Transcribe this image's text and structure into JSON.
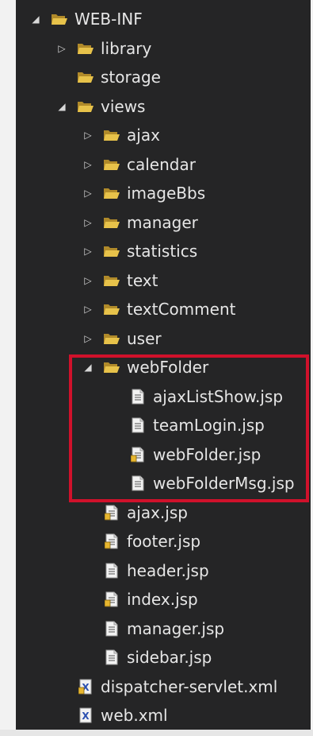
{
  "tree": {
    "items": [
      {
        "label": "WEB-INF",
        "depth": 0,
        "expander": "expanded",
        "icon": "folder-open-icon"
      },
      {
        "label": "library",
        "depth": 1,
        "expander": "collapsed",
        "icon": "folder-open-icon"
      },
      {
        "label": "storage",
        "depth": 1,
        "expander": "none",
        "icon": "folder-open-icon"
      },
      {
        "label": "views",
        "depth": 1,
        "expander": "expanded",
        "icon": "folder-open-icon"
      },
      {
        "label": "ajax",
        "depth": 2,
        "expander": "collapsed",
        "icon": "folder-open-icon"
      },
      {
        "label": "calendar",
        "depth": 2,
        "expander": "collapsed",
        "icon": "folder-open-icon"
      },
      {
        "label": "imageBbs",
        "depth": 2,
        "expander": "collapsed",
        "icon": "folder-open-icon"
      },
      {
        "label": "manager",
        "depth": 2,
        "expander": "collapsed",
        "icon": "folder-open-icon"
      },
      {
        "label": "statistics",
        "depth": 2,
        "expander": "collapsed",
        "icon": "folder-open-icon"
      },
      {
        "label": "text",
        "depth": 2,
        "expander": "collapsed",
        "icon": "folder-open-icon"
      },
      {
        "label": "textComment",
        "depth": 2,
        "expander": "collapsed",
        "icon": "folder-open-icon"
      },
      {
        "label": "user",
        "depth": 2,
        "expander": "collapsed",
        "icon": "folder-open-icon"
      },
      {
        "label": "webFolder",
        "depth": 2,
        "expander": "expanded",
        "icon": "folder-open-icon"
      },
      {
        "label": "ajaxListShow.jsp",
        "depth": 3,
        "expander": "none",
        "icon": "jsp-file-icon"
      },
      {
        "label": "teamLogin.jsp",
        "depth": 3,
        "expander": "none",
        "icon": "jsp-file-icon"
      },
      {
        "label": "webFolder.jsp",
        "depth": 3,
        "expander": "none",
        "icon": "jsp-file-modified-icon"
      },
      {
        "label": "webFolderMsg.jsp",
        "depth": 3,
        "expander": "none",
        "icon": "jsp-file-icon"
      },
      {
        "label": "ajax.jsp",
        "depth": 2,
        "expander": "none",
        "icon": "jsp-file-modified-icon"
      },
      {
        "label": "footer.jsp",
        "depth": 2,
        "expander": "none",
        "icon": "jsp-file-modified-icon"
      },
      {
        "label": "header.jsp",
        "depth": 2,
        "expander": "none",
        "icon": "jsp-file-icon"
      },
      {
        "label": "index.jsp",
        "depth": 2,
        "expander": "none",
        "icon": "jsp-file-modified-icon"
      },
      {
        "label": "manager.jsp",
        "depth": 2,
        "expander": "none",
        "icon": "jsp-file-icon"
      },
      {
        "label": "sidebar.jsp",
        "depth": 2,
        "expander": "none",
        "icon": "jsp-file-icon"
      },
      {
        "label": "dispatcher-servlet.xml",
        "depth": 1,
        "expander": "none",
        "icon": "xml-file-modified-icon"
      },
      {
        "label": "web.xml",
        "depth": 1,
        "expander": "none",
        "icon": "xml-file-icon"
      }
    ]
  },
  "highlight": {
    "target": "webFolder",
    "color": "#d0112b"
  },
  "colors": {
    "panel": "#252526",
    "text": "#e6e6e6",
    "folder": "#e0b83f",
    "highlight": "#d0112b"
  }
}
